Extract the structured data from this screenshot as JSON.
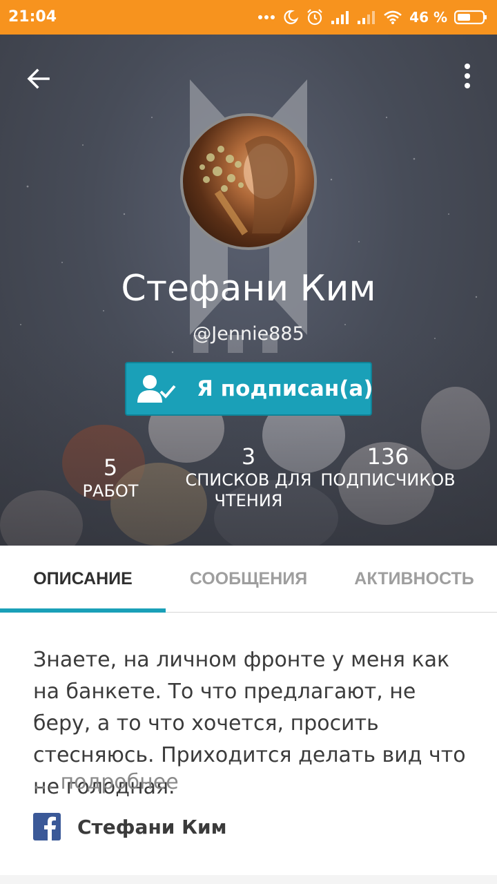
{
  "status_bar": {
    "time": "21:04",
    "battery_percent": "46 %",
    "accent": "#f7931e"
  },
  "profile": {
    "name": "Стефани Ким",
    "username": "@Jennie885",
    "follow_label": "Я подписан(а)",
    "follow_color": "#1aa0b8"
  },
  "stats": [
    {
      "value": "5",
      "label": "РАБОТ"
    },
    {
      "value": "3",
      "label": "СПИСКОВ ДЛЯ ЧТЕНИЯ"
    },
    {
      "value": "136",
      "label": "ПОДПИСЧИКОВ"
    }
  ],
  "tabs": [
    {
      "label": "ОПИСАНИЕ",
      "active": true
    },
    {
      "label": "СООБЩЕНИЯ",
      "active": false
    },
    {
      "label": "АКТИВНОСТЬ",
      "active": false
    }
  ],
  "about": {
    "description": "Знаете, на личном фронте у меня как на банкете. То что предлагают, не беру, а то что хочется, просить стесняюсь. Приходится делать вид что не голодная.",
    "more_label": "… подробнее",
    "facebook_name": "Стефани Ким"
  },
  "icons": {
    "back": "arrow-left-icon",
    "menu": "more-vertical-icon",
    "follow": "user-check-icon",
    "facebook": "facebook-icon"
  }
}
